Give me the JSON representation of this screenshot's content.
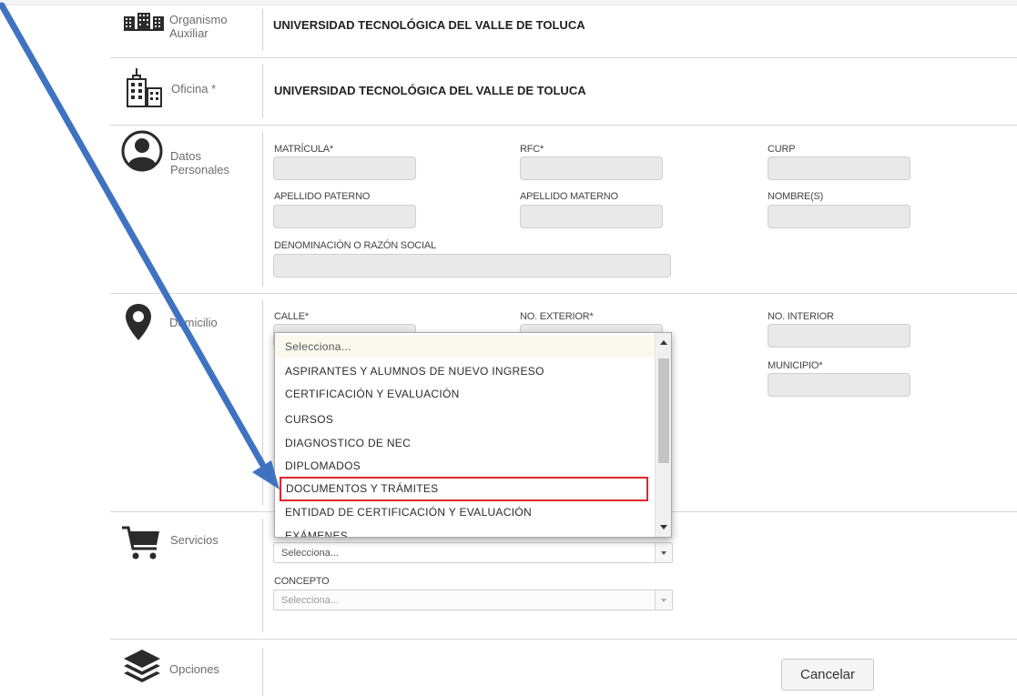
{
  "sections": {
    "organismo": {
      "label_line1": "Organismo",
      "label_line2": "Auxiliar",
      "value": "UNIVERSIDAD TECNOLÓGICA DEL VALLE DE TOLUCA"
    },
    "oficina": {
      "label": "Oficina *",
      "value": "UNIVERSIDAD TECNOLÓGICA DEL VALLE DE TOLUCA"
    },
    "datos": {
      "label_line1": "Datos",
      "label_line2": "Personales",
      "fields": {
        "matricula": "MATRÍCULA*",
        "rfc": "RFC*",
        "curp": "CURP",
        "apellido_paterno": "APELLIDO PATERNO",
        "apellido_materno": "APELLIDO MATERNO",
        "nombres": "NOMBRE(S)",
        "razon_social": "DENOMINACIÓN O RAZÓN SOCIAL"
      }
    },
    "domicilio": {
      "label": "Domicilio",
      "fields": {
        "calle": "CALLE*",
        "no_exterior": "NO. EXTERIOR*",
        "no_interior": "NO. INTERIOR",
        "municipio": "MUNICIPIO*"
      }
    },
    "servicios": {
      "label": "Servicios",
      "servicio_select": "Selecciona...",
      "concepto_label": "CONCEPTO",
      "concepto_select": "Selecciona..."
    },
    "opciones": {
      "label": "Opciones",
      "cancel_button": "Cancelar"
    }
  },
  "dropdown": {
    "items": [
      "Selecciona...",
      "ASPIRANTES Y ALUMNOS DE NUEVO INGRESO",
      "CERTIFICACIÓN Y EVALUACIÓN",
      "CURSOS",
      "DIAGNOSTICO DE NEC",
      "DIPLOMADOS",
      "DOCUMENTOS Y TRÁMITES",
      "ENTIDAD DE CERTIFICACIÓN Y EVALUACIÓN",
      "EXÁMENES"
    ],
    "highlighted_index": 6
  },
  "colors": {
    "highlight_border": "#e1262c",
    "annotation_arrow": "#3f73c2",
    "input_fill": "#e9e9e9"
  }
}
